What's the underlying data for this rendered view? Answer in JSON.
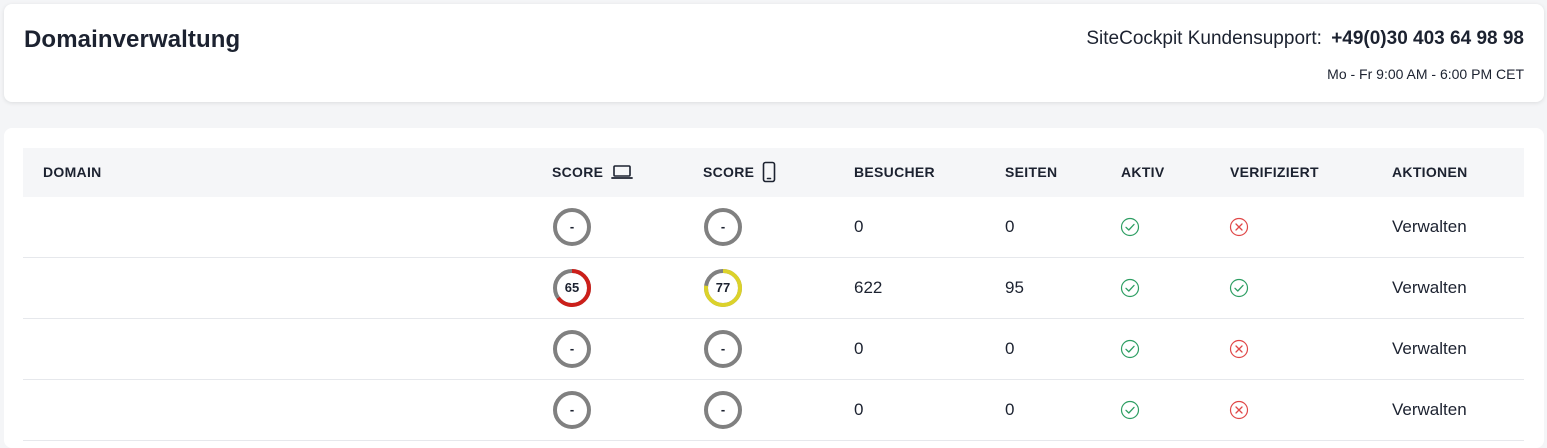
{
  "header": {
    "title": "Domainverwaltung",
    "support_label": "SiteCockpit Kundensupport:",
    "support_phone": "+49(0)30 403 64 98 98",
    "support_hours": "Mo - Fr 9:00 AM - 6:00 PM CET"
  },
  "table": {
    "columns": {
      "domain": "DOMAIN",
      "score_desktop": "SCORE",
      "score_mobile": "SCORE",
      "visitors": "BESUCHER",
      "pages": "SEITEN",
      "active": "AKTIV",
      "verified": "VERIFIZIERT",
      "actions": "AKTIONEN"
    },
    "icons": {
      "desktop": "laptop-icon",
      "mobile": "smartphone-icon",
      "ok": "check-circle-icon",
      "fail": "x-circle-icon"
    },
    "colors": {
      "ok": "#2e9e63",
      "fail": "#e04848",
      "gauge_empty": "#808080",
      "gauge_track": "#808080",
      "score_red": "#cc1f1a",
      "score_yellow": "#dcd22a"
    },
    "rows": [
      {
        "domain": "",
        "score_desktop": "-",
        "score_mobile": "-",
        "visitors": "0",
        "pages": "0",
        "active": true,
        "verified": false,
        "action": "Verwalten"
      },
      {
        "domain": "",
        "score_desktop": "65",
        "score_mobile": "77",
        "visitors": "622",
        "pages": "95",
        "active": true,
        "verified": true,
        "action": "Verwalten"
      },
      {
        "domain": "",
        "score_desktop": "-",
        "score_mobile": "-",
        "visitors": "0",
        "pages": "0",
        "active": true,
        "verified": false,
        "action": "Verwalten"
      },
      {
        "domain": "",
        "score_desktop": "-",
        "score_mobile": "-",
        "visitors": "0",
        "pages": "0",
        "active": true,
        "verified": false,
        "action": "Verwalten"
      }
    ]
  }
}
